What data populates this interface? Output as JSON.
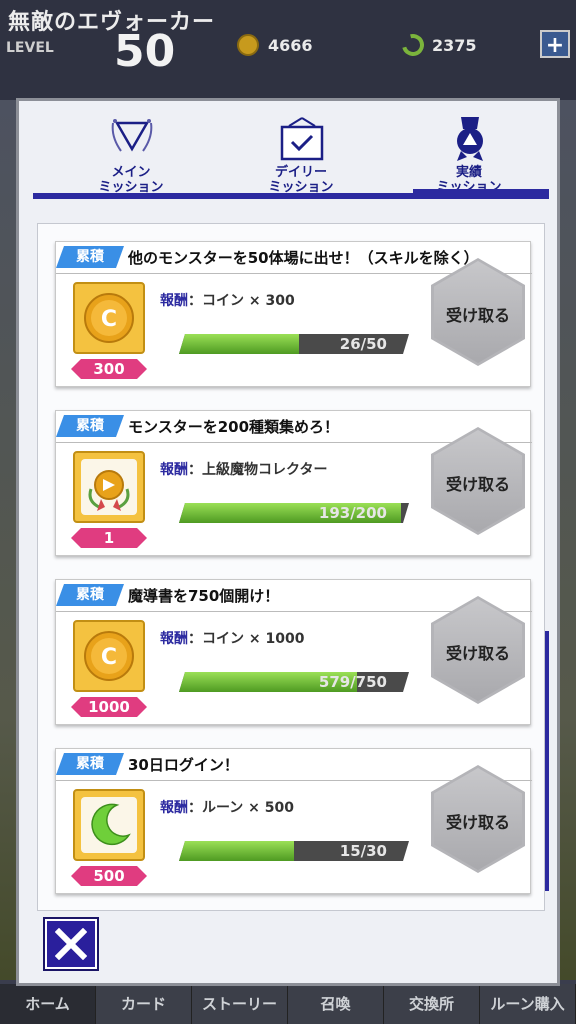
{
  "header": {
    "title": "無敵のエヴォーカー",
    "level_label": "LEVEL",
    "level": "50",
    "coins": "4666",
    "runes": "2375",
    "plus": "+"
  },
  "tabs": [
    {
      "label": "メイン\nミッション",
      "icon": "triangle-laurel-icon"
    },
    {
      "label": "デイリー\nミッション",
      "icon": "calendar-check-icon"
    },
    {
      "label": "実績\nミッション",
      "icon": "medal-icon"
    }
  ],
  "missions": [
    {
      "badge": "累積",
      "title": "他のモンスターを50体場に出せ！（スキルを除く）",
      "reward_label": "報酬",
      "reward": "：コイン × 300",
      "reward_icon": "coin-icon",
      "count": "300",
      "progress": "26/50",
      "progress_value": 0.52,
      "claim": "受け取る"
    },
    {
      "badge": "累積",
      "title": "モンスターを200種類集めろ！",
      "reward_label": "報酬",
      "reward": "：上級魔物コレクター",
      "reward_icon": "medal-badge-icon",
      "count": "1",
      "progress": "193/200",
      "progress_value": 0.965,
      "claim": "受け取る"
    },
    {
      "badge": "累積",
      "title": "魔導書を750個開け！",
      "reward_label": "報酬",
      "reward": "：コイン × 1000",
      "reward_icon": "coin-icon",
      "count": "1000",
      "progress": "579/750",
      "progress_value": 0.772,
      "claim": "受け取る"
    },
    {
      "badge": "累積",
      "title": "30日ログイン！",
      "reward_label": "報酬",
      "reward": "：ルーン × 500",
      "reward_icon": "rune-icon",
      "count": "500",
      "progress": "15/30",
      "progress_value": 0.5,
      "claim": "受け取る"
    }
  ],
  "nav": [
    "ホーム",
    "カード",
    "ストーリー",
    "召喚",
    "交換所",
    "ルーン購入"
  ],
  "colors": {
    "accent": "#2c2aa0",
    "badge": "#3a8fe6",
    "count": "#e03c80",
    "gold": "#f4c240"
  }
}
